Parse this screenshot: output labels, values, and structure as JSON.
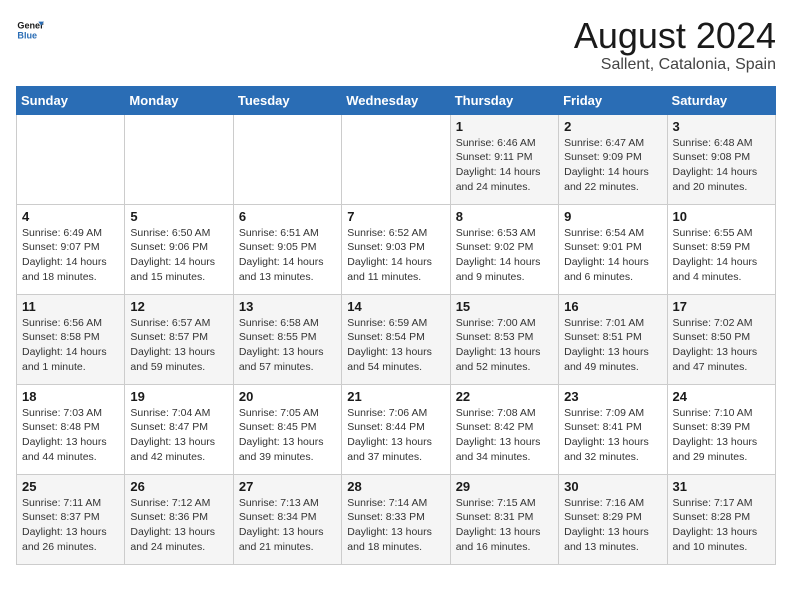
{
  "header": {
    "logo_general": "General",
    "logo_blue": "Blue",
    "month_year": "August 2024",
    "location": "Sallent, Catalonia, Spain"
  },
  "days_of_week": [
    "Sunday",
    "Monday",
    "Tuesday",
    "Wednesday",
    "Thursday",
    "Friday",
    "Saturday"
  ],
  "weeks": [
    [
      {
        "day": "",
        "info": ""
      },
      {
        "day": "",
        "info": ""
      },
      {
        "day": "",
        "info": ""
      },
      {
        "day": "",
        "info": ""
      },
      {
        "day": "1",
        "info": "Sunrise: 6:46 AM\nSunset: 9:11 PM\nDaylight: 14 hours\nand 24 minutes."
      },
      {
        "day": "2",
        "info": "Sunrise: 6:47 AM\nSunset: 9:09 PM\nDaylight: 14 hours\nand 22 minutes."
      },
      {
        "day": "3",
        "info": "Sunrise: 6:48 AM\nSunset: 9:08 PM\nDaylight: 14 hours\nand 20 minutes."
      }
    ],
    [
      {
        "day": "4",
        "info": "Sunrise: 6:49 AM\nSunset: 9:07 PM\nDaylight: 14 hours\nand 18 minutes."
      },
      {
        "day": "5",
        "info": "Sunrise: 6:50 AM\nSunset: 9:06 PM\nDaylight: 14 hours\nand 15 minutes."
      },
      {
        "day": "6",
        "info": "Sunrise: 6:51 AM\nSunset: 9:05 PM\nDaylight: 14 hours\nand 13 minutes."
      },
      {
        "day": "7",
        "info": "Sunrise: 6:52 AM\nSunset: 9:03 PM\nDaylight: 14 hours\nand 11 minutes."
      },
      {
        "day": "8",
        "info": "Sunrise: 6:53 AM\nSunset: 9:02 PM\nDaylight: 14 hours\nand 9 minutes."
      },
      {
        "day": "9",
        "info": "Sunrise: 6:54 AM\nSunset: 9:01 PM\nDaylight: 14 hours\nand 6 minutes."
      },
      {
        "day": "10",
        "info": "Sunrise: 6:55 AM\nSunset: 8:59 PM\nDaylight: 14 hours\nand 4 minutes."
      }
    ],
    [
      {
        "day": "11",
        "info": "Sunrise: 6:56 AM\nSunset: 8:58 PM\nDaylight: 14 hours\nand 1 minute."
      },
      {
        "day": "12",
        "info": "Sunrise: 6:57 AM\nSunset: 8:57 PM\nDaylight: 13 hours\nand 59 minutes."
      },
      {
        "day": "13",
        "info": "Sunrise: 6:58 AM\nSunset: 8:55 PM\nDaylight: 13 hours\nand 57 minutes."
      },
      {
        "day": "14",
        "info": "Sunrise: 6:59 AM\nSunset: 8:54 PM\nDaylight: 13 hours\nand 54 minutes."
      },
      {
        "day": "15",
        "info": "Sunrise: 7:00 AM\nSunset: 8:53 PM\nDaylight: 13 hours\nand 52 minutes."
      },
      {
        "day": "16",
        "info": "Sunrise: 7:01 AM\nSunset: 8:51 PM\nDaylight: 13 hours\nand 49 minutes."
      },
      {
        "day": "17",
        "info": "Sunrise: 7:02 AM\nSunset: 8:50 PM\nDaylight: 13 hours\nand 47 minutes."
      }
    ],
    [
      {
        "day": "18",
        "info": "Sunrise: 7:03 AM\nSunset: 8:48 PM\nDaylight: 13 hours\nand 44 minutes."
      },
      {
        "day": "19",
        "info": "Sunrise: 7:04 AM\nSunset: 8:47 PM\nDaylight: 13 hours\nand 42 minutes."
      },
      {
        "day": "20",
        "info": "Sunrise: 7:05 AM\nSunset: 8:45 PM\nDaylight: 13 hours\nand 39 minutes."
      },
      {
        "day": "21",
        "info": "Sunrise: 7:06 AM\nSunset: 8:44 PM\nDaylight: 13 hours\nand 37 minutes."
      },
      {
        "day": "22",
        "info": "Sunrise: 7:08 AM\nSunset: 8:42 PM\nDaylight: 13 hours\nand 34 minutes."
      },
      {
        "day": "23",
        "info": "Sunrise: 7:09 AM\nSunset: 8:41 PM\nDaylight: 13 hours\nand 32 minutes."
      },
      {
        "day": "24",
        "info": "Sunrise: 7:10 AM\nSunset: 8:39 PM\nDaylight: 13 hours\nand 29 minutes."
      }
    ],
    [
      {
        "day": "25",
        "info": "Sunrise: 7:11 AM\nSunset: 8:37 PM\nDaylight: 13 hours\nand 26 minutes."
      },
      {
        "day": "26",
        "info": "Sunrise: 7:12 AM\nSunset: 8:36 PM\nDaylight: 13 hours\nand 24 minutes."
      },
      {
        "day": "27",
        "info": "Sunrise: 7:13 AM\nSunset: 8:34 PM\nDaylight: 13 hours\nand 21 minutes."
      },
      {
        "day": "28",
        "info": "Sunrise: 7:14 AM\nSunset: 8:33 PM\nDaylight: 13 hours\nand 18 minutes."
      },
      {
        "day": "29",
        "info": "Sunrise: 7:15 AM\nSunset: 8:31 PM\nDaylight: 13 hours\nand 16 minutes."
      },
      {
        "day": "30",
        "info": "Sunrise: 7:16 AM\nSunset: 8:29 PM\nDaylight: 13 hours\nand 13 minutes."
      },
      {
        "day": "31",
        "info": "Sunrise: 7:17 AM\nSunset: 8:28 PM\nDaylight: 13 hours\nand 10 minutes."
      }
    ]
  ]
}
